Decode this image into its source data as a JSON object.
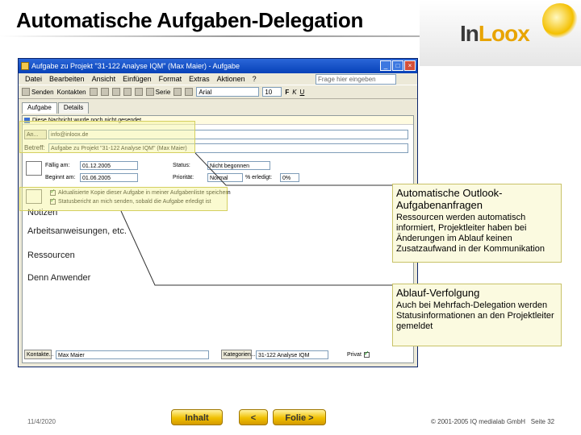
{
  "slide": {
    "title": "Automatische Aufgaben-Delegation",
    "logo": {
      "prefix": "In",
      "suffix": "Loox"
    }
  },
  "window": {
    "title": "Aufgabe zu Projekt \"31-122 Analyse IQM\" (Max Maier) - Aufgabe",
    "menu": [
      "Datei",
      "Bearbeiten",
      "Ansicht",
      "Einfügen",
      "Format",
      "Extras",
      "Aktionen",
      "?"
    ],
    "help_placeholder": "Frage hier eingeben",
    "toolbar": {
      "send": "Senden",
      "contacts": "Kontakten",
      "series": "Serie",
      "font": "Arial",
      "size": "10",
      "bold": "F",
      "italic": "K",
      "underline": "U"
    },
    "tabs": [
      "Aufgabe",
      "Details"
    ],
    "info_bar": "Diese Nachricht wurde noch nicht gesendet.",
    "to_label": "An...",
    "to_value": "info@inloox.de",
    "subject_label": "Betreff:",
    "subject_value": "Aufgabe zu Projekt \"31-122 Analyse IQM\" (Max Maier)",
    "due_label": "Fällig am:",
    "due_value": "01.12.2005",
    "start_label": "Beginnt am:",
    "start_value": "01.06.2005",
    "status_label": "Status:",
    "status_value": "Nicht begonnen",
    "priority_label": "Priorität:",
    "priority_value": "Normal",
    "done_label": "% erledigt:",
    "done_value": "0%",
    "check_copy": "Aktualisierte Kopie dieser Aufgabe in meiner Aufgabenliste speichern",
    "check_status": "Statusbericht an mich senden, sobald die Aufgabe erledigt ist",
    "body": [
      "Notizen",
      "Arbeitsanweisungen, etc.",
      "Ressourcen",
      "Denn Anwender"
    ],
    "contacts_label": "Kontakte...",
    "contacts_value": "Max Maier",
    "categories_label": "Kategorien...",
    "categories_value": "31-122 Analyse IQM",
    "private_label": "Privat"
  },
  "callouts": [
    {
      "title": "Automatische Outlook-Aufgabenanfragen",
      "text": "Ressourcen werden automatisch informiert, Projektleiter haben bei Änderungen im Ablauf keinen Zusatzaufwand in der Kommunikation"
    },
    {
      "title": "Ablauf-Verfolgung",
      "text": "Auch bei Mehrfach-Delegation werden Statusinformationen an den Projektleiter gemeldet"
    }
  ],
  "footer": {
    "date": "11/4/2020",
    "copyright": "© 2001-2005 IQ medialab GmbH",
    "page": "Seite 32",
    "btn_contents": "Inhalt",
    "btn_prev": "<",
    "btn_next": "Folie >"
  },
  "colors": {
    "titlebar": "#0842b8",
    "highlight": "#f5f396",
    "button_gold": "#f0c000"
  }
}
